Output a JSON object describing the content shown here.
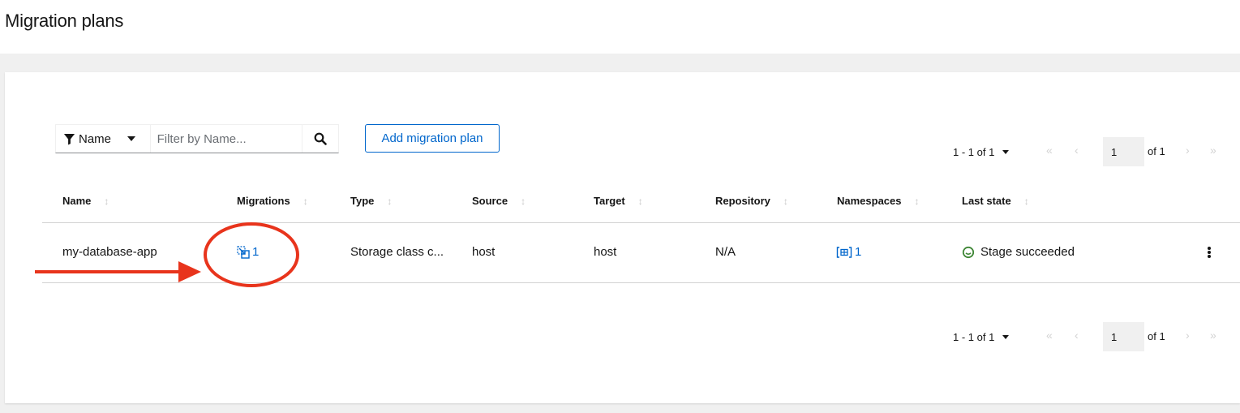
{
  "page": {
    "title": "Migration plans"
  },
  "toolbar": {
    "filter_attribute": "Name",
    "filter_placeholder": "Filter by Name...",
    "add_button_label": "Add migration plan"
  },
  "pagination": {
    "range_label": "1 - 1 of 1",
    "page_value": "1",
    "of_label": "of 1",
    "first_glyph": "«",
    "prev_glyph": "‹",
    "next_glyph": "›",
    "last_glyph": "»"
  },
  "table": {
    "columns": [
      "Name",
      "Migrations",
      "Type",
      "Source",
      "Target",
      "Repository",
      "Namespaces",
      "Last state"
    ],
    "rows": [
      {
        "name": "my-database-app",
        "migrations": "1",
        "type": "Storage class c...",
        "source": "host",
        "target": "host",
        "repository": "N/A",
        "namespaces": "1",
        "last_state": "Stage succeeded"
      }
    ]
  },
  "icons": {
    "filter": "filter-icon",
    "search": "search-icon",
    "migrations": "migration-icon",
    "namespaces": "namespace-icon",
    "status": "success-circle-icon",
    "kebab": "kebab-menu-icon"
  },
  "colors": {
    "link": "#0066cc",
    "success": "#3e8635",
    "annotation": "#e8341c"
  }
}
